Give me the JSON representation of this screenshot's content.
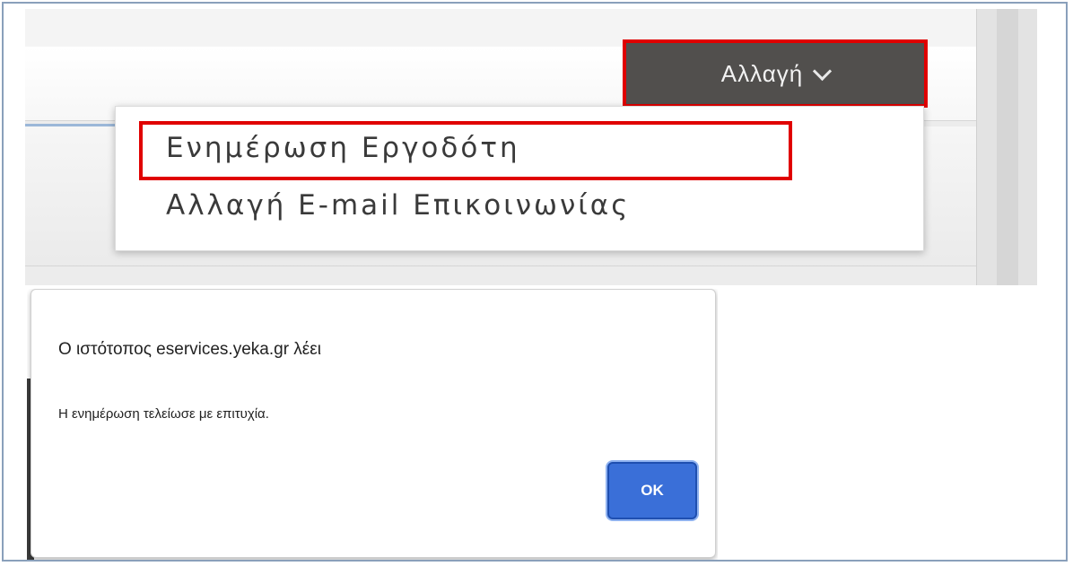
{
  "toolbar": {
    "change_button_label": "Αλλαγή"
  },
  "dropdown_menu": {
    "items": [
      {
        "label": "Ενημέρωση Εργοδότη"
      },
      {
        "label": "Αλλαγή E-mail Επικοινωνίας"
      }
    ]
  },
  "alert_dialog": {
    "title": "Ο ιστότοπος  eservices.yeka.gr λέει",
    "message": "Η ενημέρωση τελείωσε με επιτυχία.",
    "ok_label": "OK"
  },
  "colors": {
    "highlight_border": "#e00000",
    "change_button_bg": "#514f4d",
    "ok_button_bg": "#3a6fd8",
    "frame_border": "#8aa0bb"
  }
}
